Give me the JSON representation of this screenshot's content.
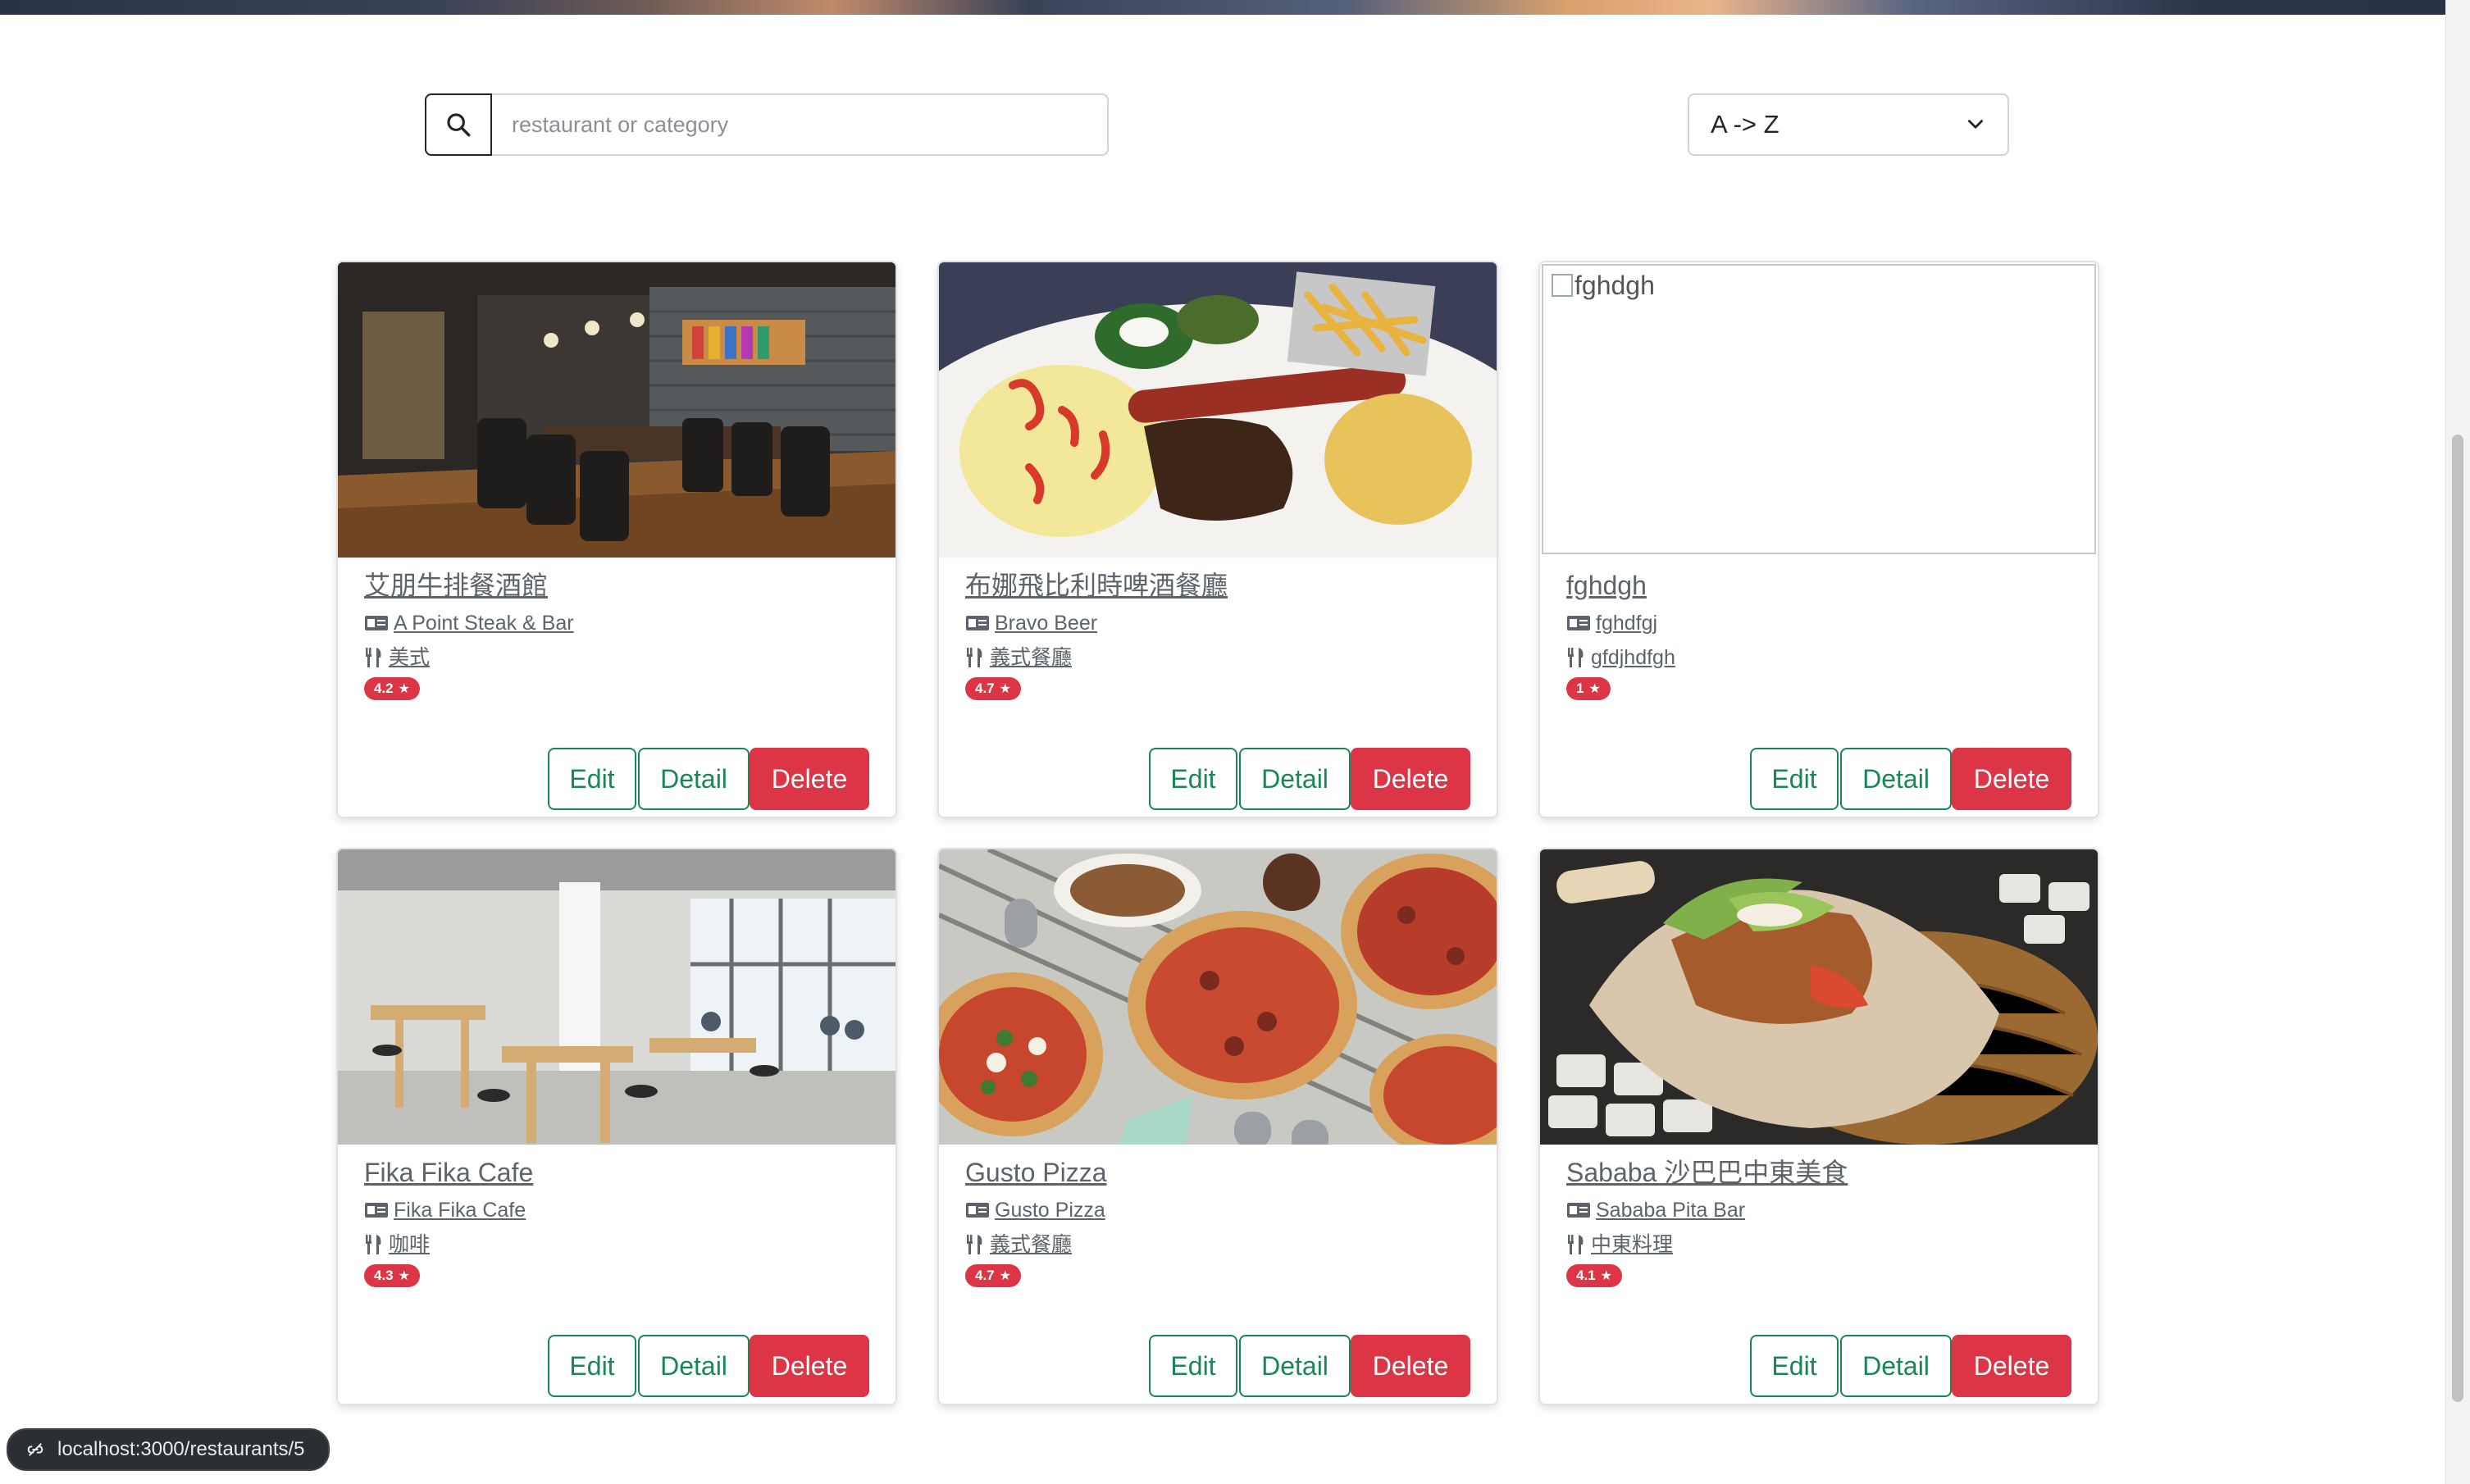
{
  "search": {
    "placeholder": "restaurant or category",
    "icon": "search-icon"
  },
  "sort": {
    "value": "A -> Z"
  },
  "colors": {
    "rating_badge": "#dc3545",
    "outline_button": "#198754",
    "delete_button": "#dc3545"
  },
  "actions": {
    "edit": "Edit",
    "detail": "Detail",
    "delete": "Delete"
  },
  "restaurants": [
    {
      "name": "艾朋牛排餐酒館",
      "name_en": "A Point Steak & Bar",
      "category": "美式",
      "rating": "4.2"
    },
    {
      "name": "布娜飛比利時啤酒餐廳",
      "name_en": "Bravo Beer",
      "category": "義式餐廳",
      "rating": "4.7"
    },
    {
      "name": "fghdgh",
      "name_en": "fghdfgj",
      "category": "gfdjhdfgh",
      "rating": "1",
      "image_alt": "fghdgh"
    },
    {
      "name": "Fika Fika Cafe",
      "name_en": "Fika Fika Cafe",
      "category": "咖啡",
      "rating": "4.3"
    },
    {
      "name": "Gusto Pizza",
      "name_en": "Gusto Pizza",
      "category": "義式餐廳",
      "rating": "4.7"
    },
    {
      "name": "Sababa 沙巴巴中東美食",
      "name_en": "Sababa Pita Bar",
      "category": "中東料理",
      "rating": "4.1"
    }
  ],
  "status_bar": {
    "url": "localhost:3000/restaurants/5"
  }
}
